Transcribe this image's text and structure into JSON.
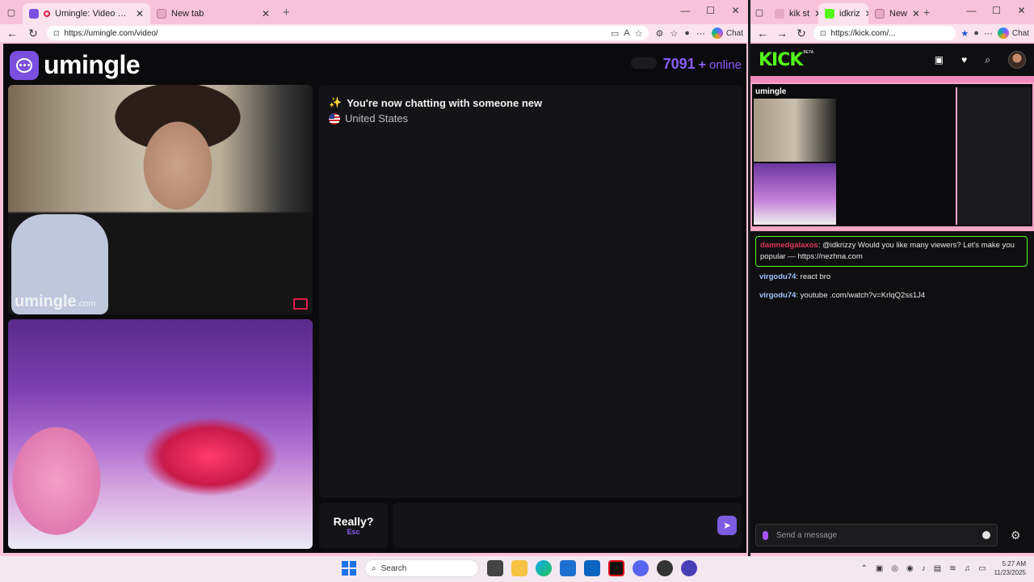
{
  "left_window": {
    "tabs": [
      {
        "label": "Umingle: Video Chat with St",
        "active": true
      },
      {
        "label": "New tab",
        "active": false
      }
    ],
    "new_tab": "+",
    "url": "https://umingle.com/video/",
    "chat_label": "Chat"
  },
  "umingle": {
    "brand": "umingle",
    "online_count": "7091",
    "online_plus": "+",
    "online_label": "online",
    "watermark": "umingle",
    "watermark_suffix": ".com",
    "status": "You're now chatting with someone new",
    "status_icon": "✨",
    "country": "United States",
    "esc_button": {
      "label": "Really?",
      "hint": "Esc"
    },
    "message_placeholder": ""
  },
  "right_window": {
    "tabs": [
      {
        "label": "kik st",
        "active": false
      },
      {
        "label": "idkriz",
        "active": true
      },
      {
        "label": "New",
        "active": false
      }
    ],
    "url": "https://kick.com/...",
    "chat_label": "Chat"
  },
  "kick": {
    "logo": "KICK",
    "beta": "BETA",
    "preview_brand": "umingle",
    "chat": [
      {
        "user": "damnedgalaxos",
        "user_color": "#e0355a",
        "text": ": @idkrizzy Would you like many viewers? Let's make you popular — https://nezhna.com",
        "highlight": true
      },
      {
        "user": "virgodu74",
        "user_color": "#9ec3ff",
        "text": ": react bro",
        "highlight": false
      },
      {
        "user": "virgodu74",
        "user_color": "#9ec3ff",
        "text": ": youtube .com/watch?v=KrlqQ2ss1J4",
        "highlight": false
      }
    ],
    "input_placeholder": "Send a message"
  },
  "taskbar": {
    "search_label": "Search",
    "time": "5:27 AM",
    "date": "11/23/2025"
  },
  "colors": {
    "accent": "#8b5cf6",
    "kick_green": "#53fc18",
    "chrome_pink": "#f8c3da"
  }
}
